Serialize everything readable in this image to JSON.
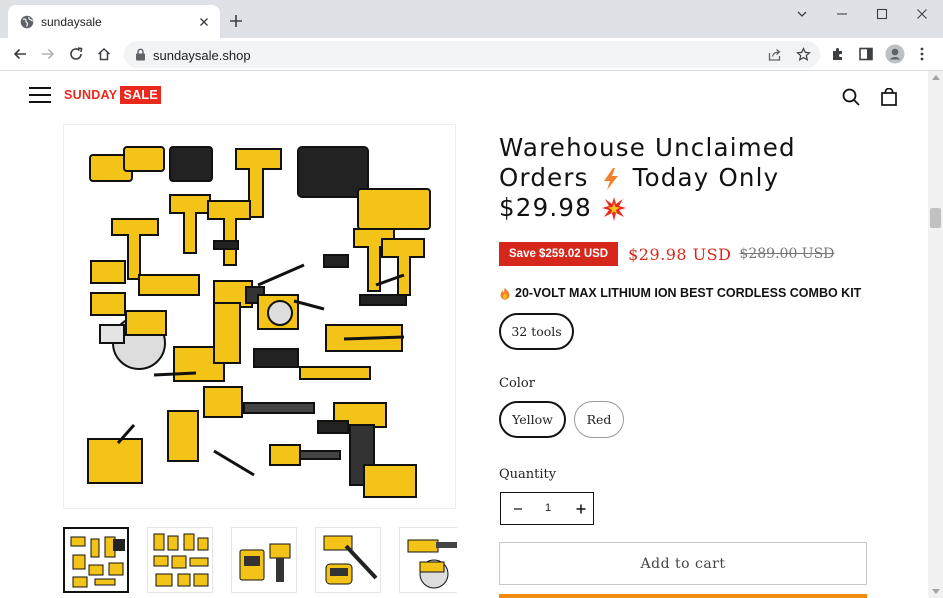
{
  "browser": {
    "tab_title": "sundaysale",
    "url": "sundaysale.shop"
  },
  "site": {
    "logo_text_1": "SUNDAY",
    "logo_text_2": "SALE",
    "brand_color": "#e8291c"
  },
  "product": {
    "title_line_1": "Warehouse Unclaimed",
    "title_line_2a": "Orders",
    "title_line_2b": "Today Only",
    "title_line_3": "$29.98",
    "save_badge": "Save $259.02 USD",
    "price_sale": "$29.98 USD",
    "price_compare": "$289.00 USD",
    "kit_description": "20-VOLT MAX LITHIUM ION BEST CORDLESS COMBO KIT",
    "variant_option": "32 tools",
    "color_label": "Color",
    "colors": [
      "Yellow",
      "Red"
    ],
    "selected_color": "Yellow",
    "quantity_label": "Quantity",
    "quantity_value": "1",
    "add_to_cart": "Add to cart",
    "sale_color": "#d5271b"
  },
  "gallery": {
    "thumbnail_count": 5
  }
}
